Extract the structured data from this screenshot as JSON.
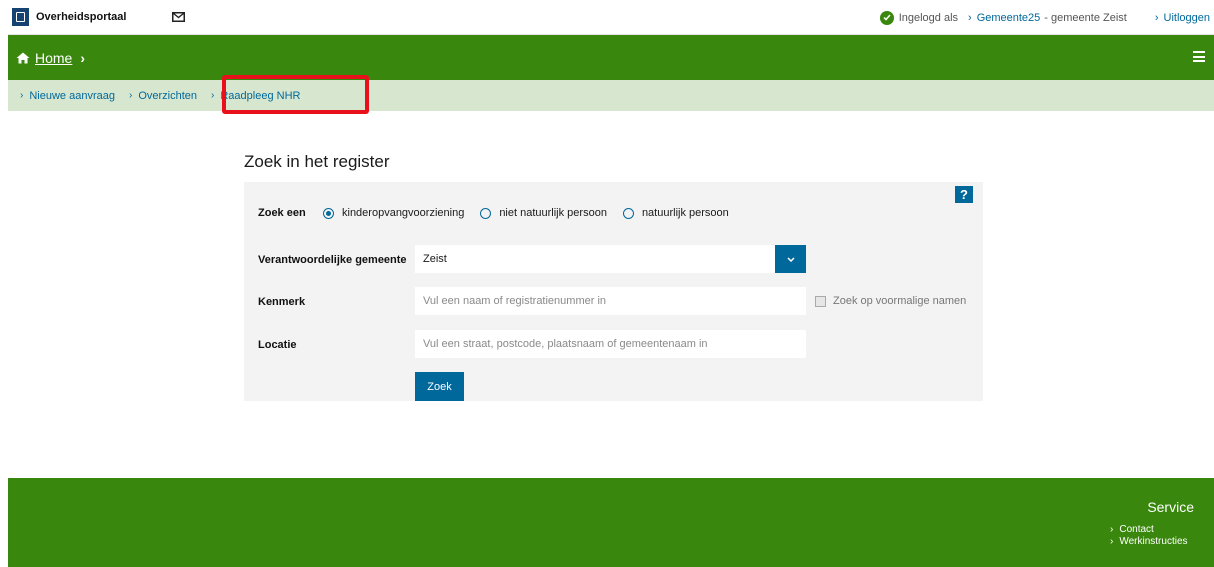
{
  "header": {
    "portal_name": "Overheidsportaal",
    "logged_in_text": "Ingelogd als",
    "user_link": "Gemeente25",
    "municipality": "- gemeente Zeist",
    "logout": "Uitloggen",
    "colors": {
      "green": "#39870c",
      "blue": "#01689b",
      "logo": "#154273"
    }
  },
  "nav": {
    "home": "Home",
    "sub_items": [
      {
        "label": "Nieuwe aanvraag"
      },
      {
        "label": "Overzichten"
      },
      {
        "label": "Raadpleeg NHR"
      }
    ]
  },
  "form": {
    "title": "Zoek in het register",
    "help": "?",
    "search_type_label": "Zoek een",
    "radio_options": [
      {
        "label": "kinderopvangvoorziening",
        "selected": true
      },
      {
        "label": "niet natuurlijk persoon",
        "selected": false
      },
      {
        "label": "natuurlijk persoon",
        "selected": false
      }
    ],
    "municipality_label": "Verantwoordelijke gemeente",
    "municipality_value": "Zeist",
    "kenmerk_label": "Kenmerk",
    "kenmerk_placeholder": "Vul een naam of registratienummer in",
    "former_names_label": "Zoek op voormalige namen",
    "location_label": "Locatie",
    "location_placeholder": "Vul een straat, postcode, plaatsnaam of gemeentenaam in",
    "submit": "Zoek"
  },
  "footer": {
    "title": "Service",
    "links": [
      {
        "label": "Contact"
      },
      {
        "label": "Werkinstructies"
      }
    ]
  }
}
